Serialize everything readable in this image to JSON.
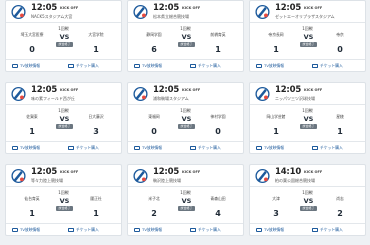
{
  "cards": [
    {
      "time": "12:05",
      "kick": "KICK OFF",
      "venue": "NACK5スタジアム大宮",
      "round": "1回戦",
      "home_team": "埼玉大宮医療",
      "away_team": "大宮学院",
      "home_score": "0",
      "away_score": "1",
      "status": "試合終了",
      "vs": "VS",
      "tv_label": "TV放映情報",
      "ticket_label": "チケット購入"
    },
    {
      "time": "12:05",
      "kick": "KICK OFF",
      "venue": "松本県立総合競技場",
      "round": "1回戦",
      "home_team": "静岡学園",
      "away_team": "前橋育英",
      "home_score": "6",
      "away_score": "1",
      "status": "試合終了",
      "vs": "VS",
      "tv_label": "TV放映情報",
      "ticket_label": "チケット購入"
    },
    {
      "time": "12:05",
      "kick": "KICK OFF",
      "venue": "ゼットエーオリプラザスタジアム",
      "round": "1回戦",
      "home_team": "帝京長岡",
      "away_team": "帝京",
      "home_score": "1",
      "away_score": "0",
      "status": "試合終了",
      "vs": "VS",
      "tv_label": "TV放映情報",
      "ticket_label": "チケット購入"
    },
    {
      "time": "12:05",
      "kick": "KICK OFF",
      "venue": "味の素フィールド西が丘",
      "round": "1回戦",
      "home_team": "佐賀東",
      "away_team": "日大藤沢",
      "home_score": "1",
      "away_score": "3",
      "status": "試合終了",
      "vs": "VS",
      "tv_label": "TV放映情報",
      "ticket_label": "チケット購入"
    },
    {
      "time": "12:05",
      "kick": "KICK OFF",
      "venue": "浦和駒場スタジアム",
      "round": "1回戦",
      "home_team": "東福岡",
      "away_team": "神村学園",
      "home_score": "0",
      "away_score": "0",
      "status": "試合終了",
      "vs": "VS",
      "tv_label": "TV放映情報",
      "ticket_label": "チケット購入"
    },
    {
      "time": "12:05",
      "kick": "KICK OFF",
      "venue": "ニッパツ三ツ沢球技場",
      "round": "1回戦",
      "home_team": "岡山学芸館",
      "away_team": "星稜",
      "home_score": "1",
      "away_score": "1",
      "status": "試合終了",
      "vs": "VS",
      "tv_label": "TV放映情報",
      "ticket_label": "チケット購入"
    },
    {
      "time": "12:05",
      "kick": "KICK OFF",
      "venue": "等々力陸上競技場",
      "round": "1回戦",
      "home_team": "仙台育英",
      "away_team": "履正社",
      "home_score": "1",
      "away_score": "1",
      "status": "試合終了",
      "vs": "VS",
      "tv_label": "TV放映情報",
      "ticket_label": "チケット購入"
    },
    {
      "time": "12:05",
      "kick": "KICK OFF",
      "venue": "駒沢陸上競技場",
      "round": "1回戦",
      "home_team": "米子北",
      "away_team": "青森山田",
      "home_score": "2",
      "away_score": "4",
      "status": "試合終了",
      "vs": "VS",
      "tv_label": "TV放映情報",
      "ticket_label": "チケット購入"
    },
    {
      "time": "14:10",
      "kick": "KICK OFF",
      "venue": "柏の葉公園総合競技場",
      "round": "1回戦",
      "home_team": "大津",
      "away_team": "尚志",
      "home_score": "3",
      "away_score": "2",
      "status": "試合終了",
      "vs": "VS",
      "tv_label": "TV放映情報",
      "ticket_label": "チケット購入"
    }
  ],
  "colors": {
    "accent": "#1d5a9c",
    "badge": "#6b7680",
    "background": "#eef1f4"
  },
  "icons": {
    "logo": "tournament-logo-icon",
    "tv": "tv-icon",
    "ticket": "ticket-icon"
  }
}
